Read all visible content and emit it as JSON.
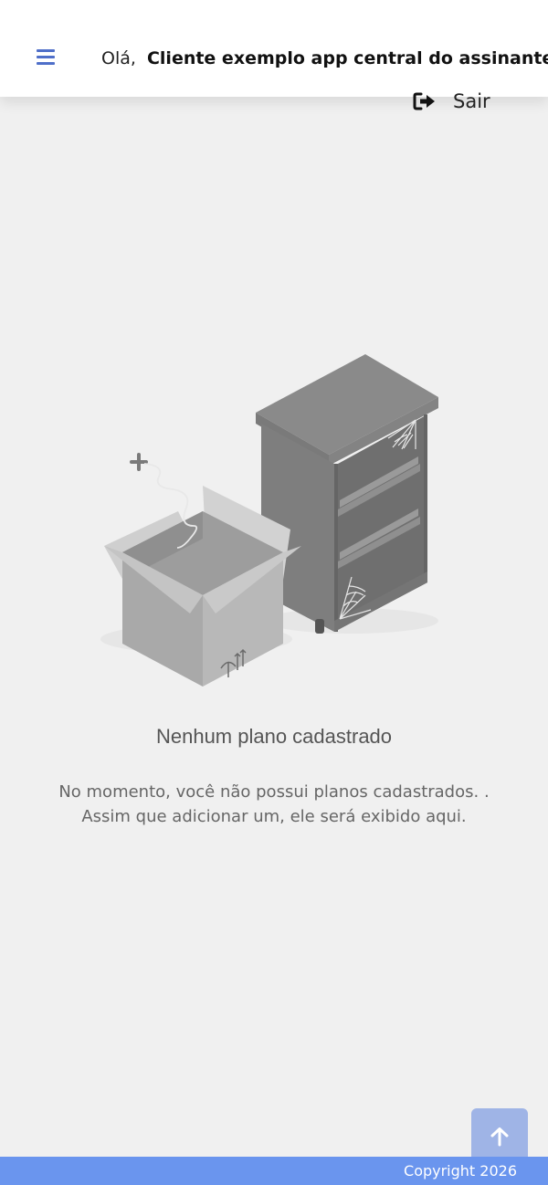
{
  "header": {
    "greeting": "Olá,",
    "customer_name": "Cliente exemplo app central do assinante",
    "menu_icon": "hamburger-menu-icon",
    "logout_icon": "sign-out-icon",
    "logout_label": "Sair"
  },
  "empty_state": {
    "illustration": "empty-box-and-shelf-illustration",
    "title": "Nenhum plano cadastrado",
    "line1": "No momento, você não possui planos cadastrados. .",
    "line2": "Assim que adicionar um, ele será exibido aqui."
  },
  "scroll_top": {
    "icon": "arrow-up-icon"
  },
  "footer": {
    "copyright": "Copyright 2026"
  },
  "colors": {
    "accent": "#4f6fc9",
    "footer_bg": "#6a95ee",
    "scroll_button_bg": "#9fb4e6",
    "page_bg": "#f0f0f0"
  }
}
